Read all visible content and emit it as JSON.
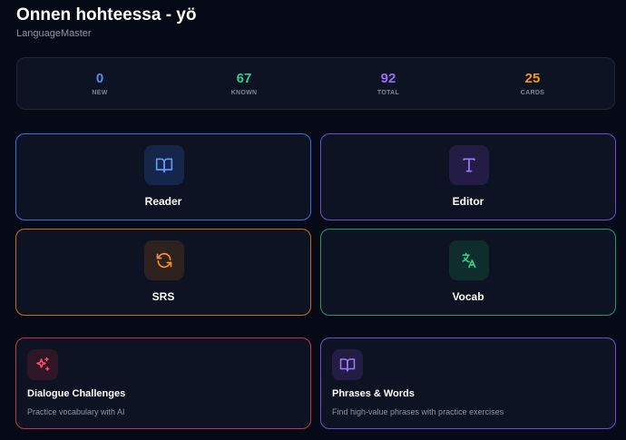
{
  "header": {
    "title": "Onnen hohteessa - yö",
    "subtitle": "LanguageMaster"
  },
  "stats": [
    {
      "value": "0",
      "label": "NEW",
      "color": "#4f8ef7"
    },
    {
      "value": "67",
      "label": "KNOWN",
      "color": "#34c98e"
    },
    {
      "value": "92",
      "label": "TOTAL",
      "color": "#9d6cf5"
    },
    {
      "value": "25",
      "label": "CARDS",
      "color": "#f5922a"
    }
  ],
  "tiles": {
    "reader": {
      "label": "Reader",
      "icon": "book-open-icon",
      "accent": "#3d6fd6"
    },
    "editor": {
      "label": "Editor",
      "icon": "type-icon",
      "accent": "#6a4fd0"
    },
    "srs": {
      "label": "SRS",
      "icon": "refresh-icon",
      "accent": "#c46a1d"
    },
    "vocab": {
      "label": "Vocab",
      "icon": "translate-icon",
      "accent": "#1f9a6b"
    }
  },
  "features": {
    "dialogue": {
      "title": "Dialogue Challenges",
      "description": "Practice vocabulary with AI",
      "icon": "sparkles-icon",
      "accent": "#c0344a"
    },
    "phrases": {
      "title": "Phrases & Words",
      "description": "Find high-value phrases with practice exercises",
      "icon": "book-open-icon",
      "accent": "#6a4fd0"
    }
  }
}
